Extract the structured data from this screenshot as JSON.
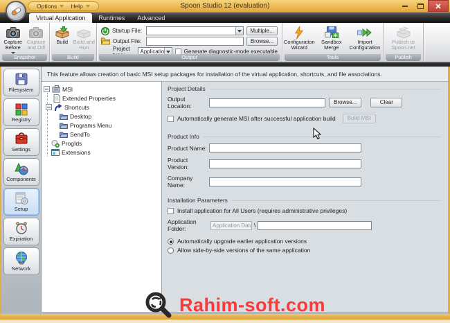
{
  "window": {
    "title": "Spoon Studio 12 (evaluation)",
    "menu": {
      "options": "Options",
      "help": "Help"
    }
  },
  "tabs": {
    "virtual_application": "Virtual Application",
    "runtimes": "Runtimes",
    "advanced": "Advanced"
  },
  "ribbon": {
    "snapshot": {
      "group_label": "Snapshot",
      "capture_before": "Capture Before",
      "capture_and_diff": "Capture and Diff"
    },
    "build": {
      "group_label": "Build",
      "build": "Build",
      "build_and_run": "Build and Run"
    },
    "output": {
      "group_label": "Output",
      "startup_file_label": "Startup File:",
      "output_file_label": "Output File:",
      "project_type_label": "Project type:",
      "project_type_value": "Application",
      "multiple_button": "Multiple...",
      "browse_button": "Browse...",
      "diagnostic_checkbox_label": "Generate diagnostic-mode executable"
    },
    "tools": {
      "group_label": "Tools",
      "configuration_wizard": "Configuration Wizard",
      "sandbox_merge": "Sandbox Merge",
      "import_configuration": "Import Configuration"
    },
    "publish": {
      "group_label": "Publish",
      "publish_to_spoon": "Publish to Spoon.net"
    }
  },
  "sidebar": {
    "items": [
      {
        "label": "Filesystem",
        "selected": false
      },
      {
        "label": "Registry",
        "selected": false
      },
      {
        "label": "Settings",
        "selected": false
      },
      {
        "label": "Components",
        "selected": false
      },
      {
        "label": "Setup",
        "selected": true
      },
      {
        "label": "Expiration",
        "selected": false
      },
      {
        "label": "Network",
        "selected": false
      }
    ]
  },
  "description": "This feature allows creation of basic MSI setup packages for installation of the virtual application, shortcuts, and file associations.",
  "tree": {
    "items": [
      {
        "label": "MSI",
        "level": 0,
        "expanded": true
      },
      {
        "label": "Extended Properties",
        "level": 1
      },
      {
        "label": "Shortcuts",
        "level": 1,
        "expanded": true
      },
      {
        "label": "Desktop",
        "level": 2
      },
      {
        "label": "Programs Menu",
        "level": 2
      },
      {
        "label": "SendTo",
        "level": 2
      },
      {
        "label": "ProgIds",
        "level": 1
      },
      {
        "label": "Extensions",
        "level": 1
      }
    ]
  },
  "form": {
    "project_details": {
      "header": "Project Details",
      "output_location_label": "Output Location:",
      "output_location_value": "",
      "browse_button": "Browse...",
      "clear_button": "Clear",
      "auto_generate_checkbox_label": "Automatically generate MSI after successful application build",
      "auto_generate_checked": false,
      "build_msi_button": "Build MSI"
    },
    "product_info": {
      "header": "Product Info",
      "product_name_label": "Product Name:",
      "product_name_value": "",
      "product_version_label": "Product Version:",
      "product_version_value": "",
      "company_name_label": "Company Name:",
      "company_name_value": ""
    },
    "installation": {
      "header": "Installation Parameters",
      "all_users_checkbox_label": "Install application for All Users (requires administrative privileges)",
      "all_users_checked": false,
      "app_folder_label": "Application Folder:",
      "app_folder_prefix": "Application Data",
      "app_folder_separator": "\\",
      "app_folder_value": "",
      "radio_upgrade_label": "Automatically upgrade earlier application versions",
      "radio_side_by_side_label": "Allow side-by-side versions of the same application",
      "selected_radio": "upgrade"
    }
  },
  "watermark": {
    "text": "Rahim-soft.com",
    "color": "#FA3A3A"
  },
  "colors": {
    "titlebar_orange": "#EFBE58",
    "close_red": "#C94F44",
    "selected_sidebar_border": "#6E9CD4",
    "panel_gray": "#D9DEE3"
  }
}
